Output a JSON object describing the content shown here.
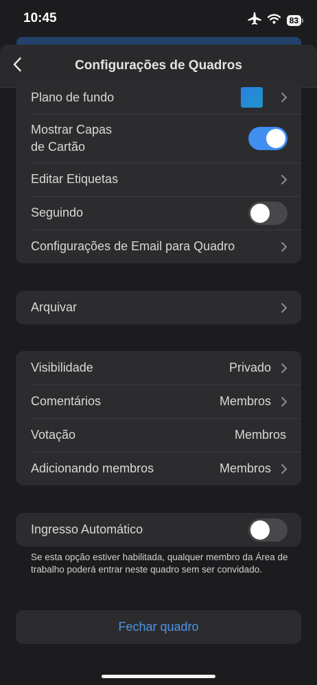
{
  "status_bar": {
    "time": "10:45",
    "battery": "83",
    "icons": [
      "airplane-icon",
      "wifi-icon",
      "battery-icon"
    ]
  },
  "header": {
    "title": "Configurações de Quadros",
    "back_icon": "chevron-left-icon"
  },
  "card1": {
    "background": {
      "label": "Plano de fundo",
      "swatch_color": "#2a7fe0"
    },
    "card_covers": {
      "label_line1": "Mostrar Capas",
      "label_line2": "de Cartão",
      "on": true
    },
    "edit_labels": {
      "label": "Editar Etiquetas"
    },
    "following": {
      "label": "Seguindo",
      "on": false
    },
    "email_settings": {
      "label": "Configurações de Email para Quadro"
    }
  },
  "card2": {
    "archive": {
      "label": "Arquivar"
    }
  },
  "card3": {
    "visibility": {
      "label": "Visibilidade",
      "value": "Privado"
    },
    "comments": {
      "label": "Comentários",
      "value": "Membros"
    },
    "voting": {
      "label": "Votação",
      "value": "Membros"
    },
    "adding_members": {
      "label": "Adicionando membros",
      "value": "Membros"
    }
  },
  "card4": {
    "auto_join": {
      "label": "Ingresso Automático",
      "on": false
    },
    "footnote": "Se esta opção estiver habilitada, qualquer membro da Área de trabalho poderá entrar neste quadro sem ser convidado."
  },
  "close_board": {
    "label": "Fechar quadro"
  },
  "colors": {
    "accent": "#3f8ef0",
    "link": "#4f93e8",
    "background": "#1c1c1e",
    "card": "#2c2c2e"
  }
}
